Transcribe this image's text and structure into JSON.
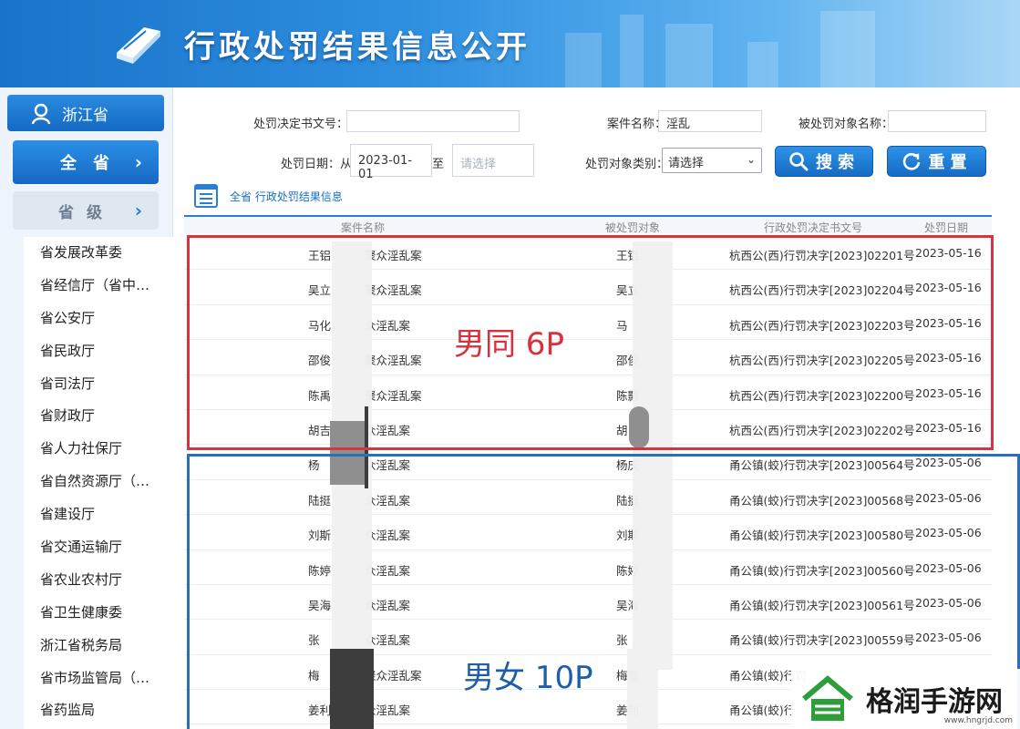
{
  "header": {
    "title": "行政处罚结果信息公开"
  },
  "sidebar": {
    "province": "浙江省",
    "all_label": "全省",
    "level_label": "省级",
    "items": [
      "省发展改革委",
      "省经信厅（省中…",
      "省公安厅",
      "省民政厅",
      "省司法厅",
      "省财政厅",
      "省人力社保厅",
      "省自然资源厅（…",
      "省建设厅",
      "省交通运输厅",
      "省农业农村厅",
      "省卫生健康委",
      "浙江省税务局",
      "省市场监管局（…",
      "省药监局"
    ]
  },
  "filters": {
    "doc_no_label": "处罚决定书文号：",
    "case_name_label": "案件名称：",
    "case_name_value": "淫乱",
    "target_name_label": "被处罚对象名称：",
    "date_label": "处罚日期：从",
    "date_from": "2023-01-01",
    "date_to_label": "至",
    "date_to_placeholder": "请选择",
    "target_type_label": "处罚对象类别：",
    "target_type_value": "请选择",
    "search_label": "搜索",
    "reset_label": "重置"
  },
  "breadcrumb": "全省 行政处罚结果信息",
  "table": {
    "headers": [
      "案件名称",
      "被处罚对象",
      "行政处罚决定书文号",
      "处罚日期"
    ],
    "rows": [
      {
        "case": "王铝",
        "case2": "聚众淫乱案",
        "target": "王铝",
        "doc": "杭西公(西)行罚决字[2023]02201号",
        "date": "2023-05-16"
      },
      {
        "case": "吴立",
        "case2": "聚众淫乱案",
        "target": "吴立",
        "doc": "杭西公(西)行罚决字[2023]02204号",
        "date": "2023-05-16"
      },
      {
        "case": "马化",
        "case2": "众淫乱案",
        "target": "马",
        "doc": "杭西公(西)行罚决字[2023]02203号",
        "date": "2023-05-16"
      },
      {
        "case": "邵俊",
        "case2": "聚众淫乱案",
        "target": "邵俊",
        "doc": "杭西公(西)行罚决字[2023]02205号",
        "date": "2023-05-16"
      },
      {
        "case": "陈禹",
        "case2": "聚众淫乱案",
        "target": "陈颢",
        "doc": "杭西公(西)行罚决字[2023]02200号",
        "date": "2023-05-16"
      },
      {
        "case": "胡吉",
        "case2": "众淫乱案",
        "target": "胡",
        "doc": "杭西公(西)行罚决字[2023]02202号",
        "date": "2023-05-16"
      },
      {
        "case": "杨",
        "case2": "众淫乱案",
        "target": "杨庆",
        "doc": "甬公镇(蛟)行罚决字[2023]00564号",
        "date": "2023-05-06"
      },
      {
        "case": "陆挺",
        "case2": "众淫乱案",
        "target": "陆挺",
        "doc": "甬公镇(蛟)行罚决字[2023]00568号",
        "date": "2023-05-06"
      },
      {
        "case": "刘斯",
        "case2": "众淫乱案",
        "target": "刘斯",
        "doc": "甬公镇(蛟)行罚决字[2023]00580号",
        "date": "2023-05-06"
      },
      {
        "case": "陈婷",
        "case2": "众淫乱案",
        "target": "陈婷",
        "doc": "甬公镇(蛟)行罚决字[2023]00560号",
        "date": "2023-05-06"
      },
      {
        "case": "吴海",
        "case2": "众淫乱案",
        "target": "吴海",
        "doc": "甬公镇(蛟)行罚决字[2023]00561号",
        "date": "2023-05-06"
      },
      {
        "case": "张",
        "case2": "众淫乱案",
        "target": "张",
        "doc": "甬公镇(蛟)行罚决字[2023]00559号",
        "date": "2023-05-06"
      },
      {
        "case": "梅",
        "case2": "聚众淫乱案",
        "target": "梅雪",
        "doc": "甬公镇(蛟)行罚",
        "date": ""
      },
      {
        "case": "姜利",
        "case2": "众淫乱案",
        "target": "姜利",
        "doc": "甬公镇(蛟)行",
        "date": ""
      }
    ]
  },
  "annotations": {
    "red": "男同 6P",
    "blue": "男女 10P"
  },
  "watermark": {
    "brand": "格润手游网",
    "url": "www.hngrjd.com"
  },
  "colors": {
    "banner": "#1a73c9",
    "accent": "#2a7fd4",
    "red_frame": "#d93240",
    "blue_frame": "#2d6fb7"
  }
}
